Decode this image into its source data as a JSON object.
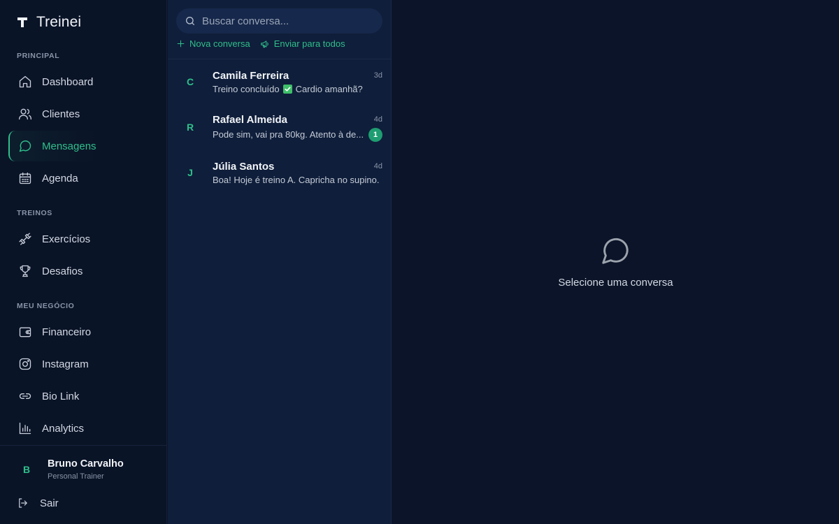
{
  "brand": {
    "name": "Treinei",
    "icon": "brand-t-icon"
  },
  "sidebar": {
    "sections": {
      "principal": "PRINCIPAL",
      "treinos": "TREINOS",
      "meu_negocio": "MEU NEGÓCIO"
    },
    "items": [
      {
        "label": "Dashboard",
        "icon": "home-icon"
      },
      {
        "label": "Clientes",
        "icon": "users-icon"
      },
      {
        "label": "Mensagens",
        "icon": "message-circle-icon",
        "active": true
      },
      {
        "label": "Agenda",
        "icon": "calendar-icon"
      },
      {
        "label": "Exercícios",
        "icon": "dumbbell-icon"
      },
      {
        "label": "Desafios",
        "icon": "trophy-icon"
      },
      {
        "label": "Financeiro",
        "icon": "wallet-icon"
      },
      {
        "label": "Instagram",
        "icon": "instagram-icon"
      },
      {
        "label": "Bio Link",
        "icon": "link-icon"
      },
      {
        "label": "Analytics",
        "icon": "bar-chart-icon"
      }
    ],
    "user": {
      "initial": "B",
      "name": "Bruno Carvalho",
      "role": "Personal Trainer"
    },
    "logout_label": "Sair"
  },
  "conversations_panel": {
    "search_placeholder": "Buscar conversa...",
    "new_conversation_label": "Nova conversa",
    "broadcast_label": "Enviar para todos",
    "conversations": [
      {
        "initial": "C",
        "name": "Camila Ferreira",
        "time": "3d",
        "preview_before": "Treino concluído",
        "preview_after": "Cardio amanhã?",
        "unread": null
      },
      {
        "initial": "R",
        "name": "Rafael Almeida",
        "time": "4d",
        "preview": "Pode sim, vai pra 80kg. Atento à de...",
        "unread": "1"
      },
      {
        "initial": "J",
        "name": "Júlia Santos",
        "time": "4d",
        "preview": "Boa! Hoje é treino A. Capricha no supino.",
        "unread": null
      }
    ]
  },
  "empty_state": {
    "text": "Selecione uma conversa",
    "icon": "message-circle-icon"
  },
  "colors": {
    "accent": "#2fbf8b",
    "background": "#0b1428",
    "panel": "#0f1e3a"
  }
}
